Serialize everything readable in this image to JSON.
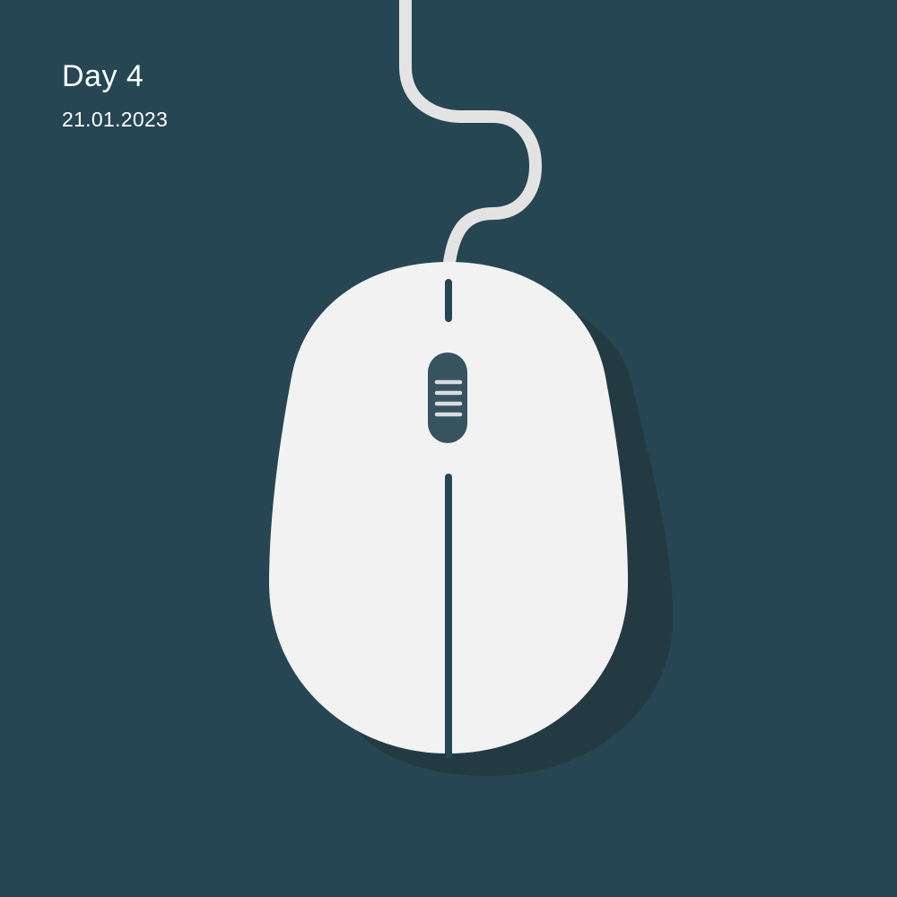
{
  "caption": {
    "title": "Day 4",
    "date": "21.01.2023"
  },
  "illustration": {
    "subject_icon": "computer-mouse-icon",
    "colors": {
      "background": "#264653",
      "mouse_body": "#f2f2f2",
      "cable": "#e6e6e6",
      "shadow": "#253b44",
      "scroll_wheel": "#37535e",
      "wheel_ridges": "#d9dde0",
      "seam": "#264653"
    }
  }
}
